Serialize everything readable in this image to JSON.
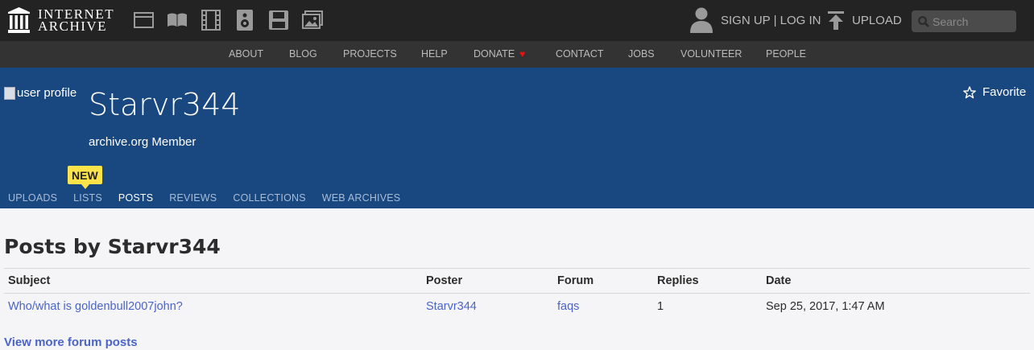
{
  "header": {
    "logo_line1": "INTERNET",
    "logo_line2": "ARCHIVE",
    "media_icons": [
      "web-icon",
      "texts-icon",
      "video-icon",
      "audio-icon",
      "software-icon",
      "images-icon"
    ],
    "signup_label": "SIGN UP",
    "separator": "|",
    "login_label": "LOG IN",
    "upload_label": "UPLOAD",
    "search_placeholder": "Search"
  },
  "nav": {
    "items": [
      "ABOUT",
      "BLOG",
      "PROJECTS",
      "HELP",
      "DONATE",
      "CONTACT",
      "JOBS",
      "VOLUNTEER",
      "PEOPLE"
    ],
    "donate_heart": "♥"
  },
  "profile": {
    "avatar_alt": "user profile",
    "username": "Starvr344",
    "member_label": "archive.org Member",
    "favorite_label": "Favorite",
    "new_badge": "NEW",
    "tabs": [
      "UPLOADS",
      "LISTS",
      "POSTS",
      "REVIEWS",
      "COLLECTIONS",
      "WEB ARCHIVES"
    ],
    "active_tab": "POSTS"
  },
  "posts": {
    "title": "Posts by Starvr344",
    "columns": [
      "Subject",
      "Poster",
      "Forum",
      "Replies",
      "Date"
    ],
    "rows": [
      {
        "subject": "Who/what is goldenbull2007john?",
        "poster": "Starvr344",
        "forum": "faqs",
        "replies": "1",
        "date": "Sep 25, 2017, 1:47 AM"
      }
    ],
    "more_label": "View more forum posts"
  },
  "colors": {
    "topbar": "#232323",
    "navbar": "#333333",
    "profile_bg": "#194880",
    "link": "#4b64c7",
    "badge": "#fde34a"
  }
}
